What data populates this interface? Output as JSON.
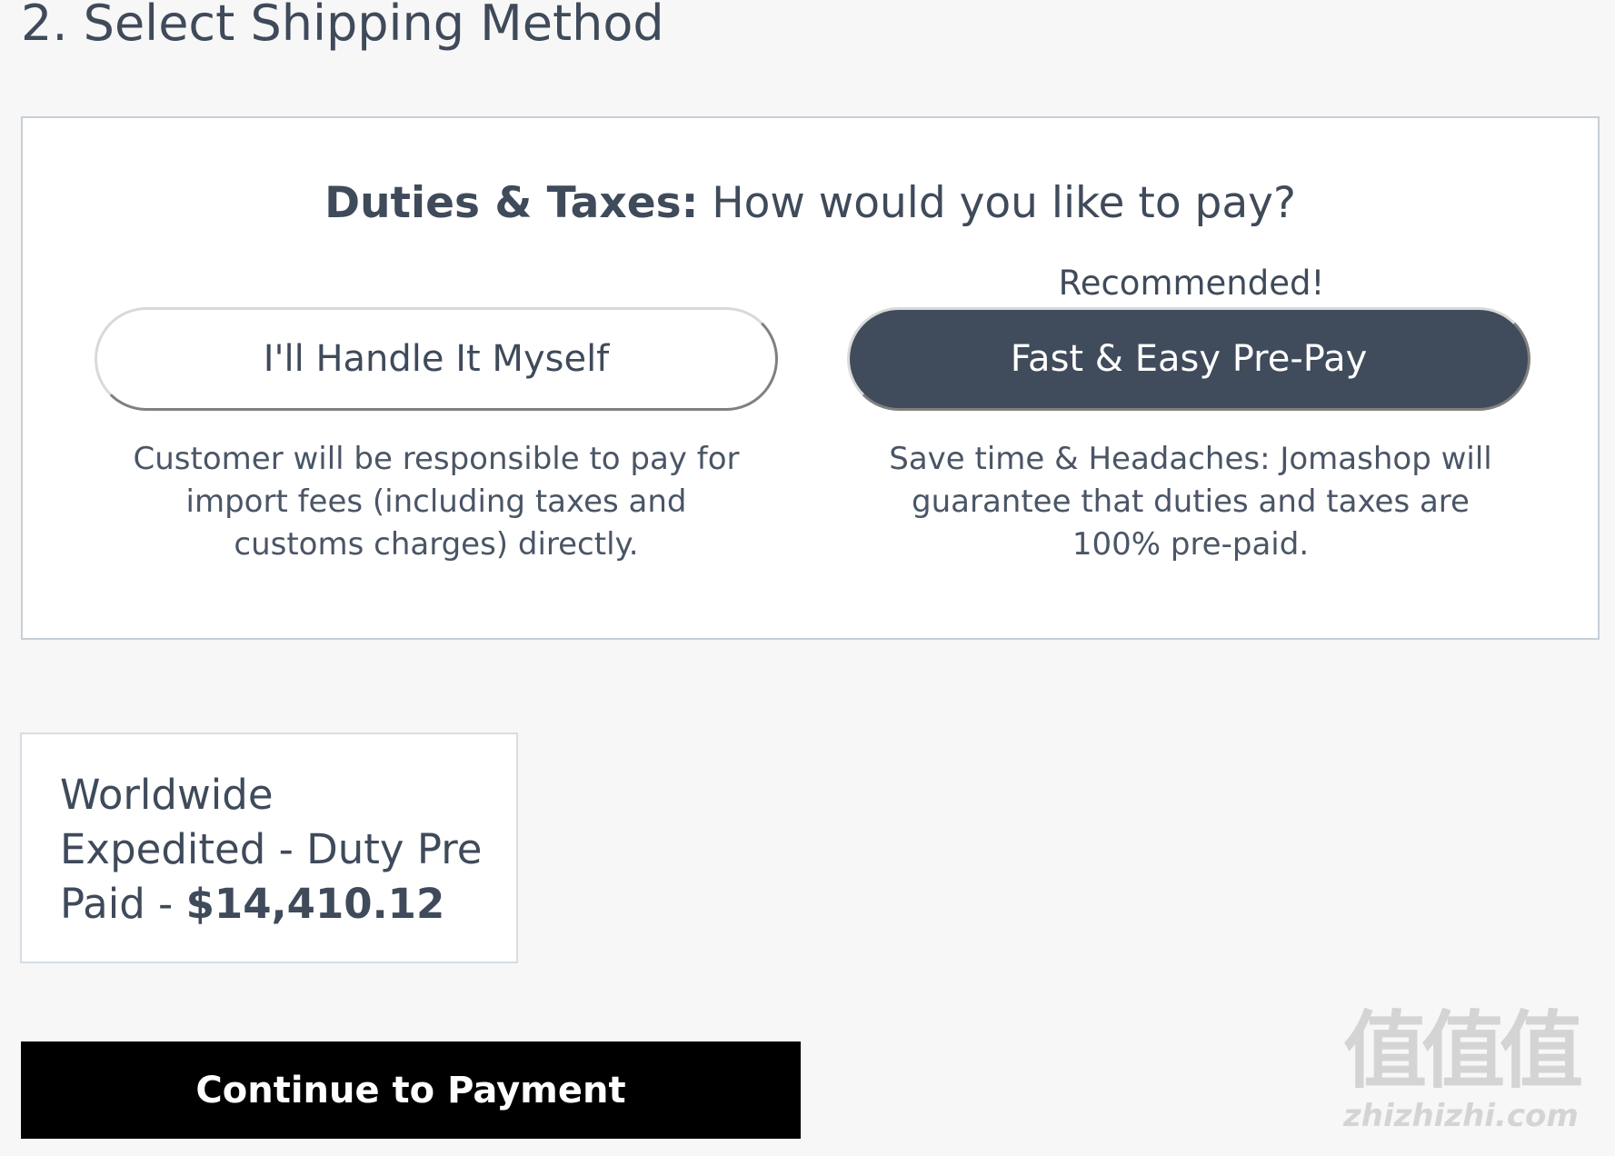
{
  "page": {
    "section_title": "2. Select Shipping Method"
  },
  "duties": {
    "heading_strong": "Duties & Taxes:",
    "heading_rest": " How would you like to pay?",
    "recommended_label": "Recommended!",
    "options": [
      {
        "label": "I'll Handle It Myself",
        "description": "Customer will be responsible to pay for import fees (including taxes and customs charges) directly.",
        "selected": false
      },
      {
        "label": "Fast & Easy Pre-Pay",
        "description": "Save time & Headaches: Jomashop will guarantee that duties and taxes are 100% pre-paid.",
        "selected": true
      }
    ]
  },
  "shipping": {
    "method_label": "Worldwide Expedited - Duty Pre Paid - ",
    "price": "$14,410.12"
  },
  "actions": {
    "continue_label": "Continue to Payment"
  },
  "watermark": {
    "glyphs": "值值值",
    "url": "zhizhizhi.com"
  },
  "colors": {
    "page_background": "#f7f7f7",
    "text_primary": "#3f4a5a",
    "selected_button": "#404b5b",
    "continue_button": "#000000"
  }
}
